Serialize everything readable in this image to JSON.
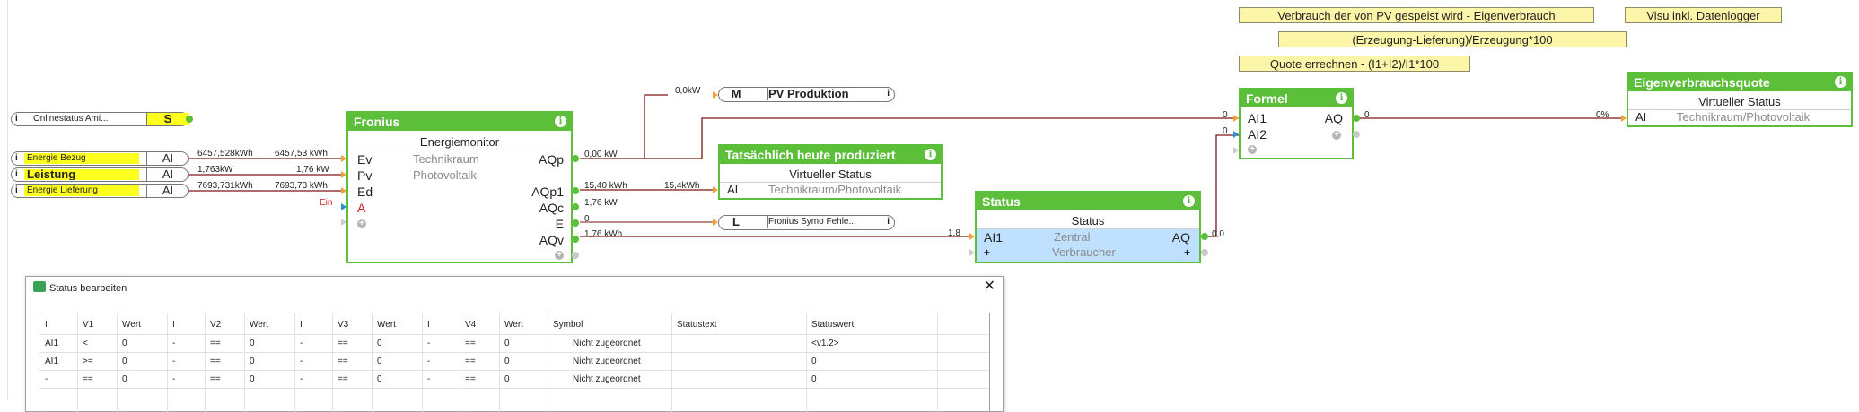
{
  "notes": {
    "eigenverbrauch": "Verbrauch der von PV gespeist wird - Eigenverbrauch",
    "visu": "Visu inkl. Datenlogger",
    "formula1": "(Erzeugung-Lieferung)/Erzeugung*100",
    "formula2": "Quote errechnen - (I1+I2)/I1*100"
  },
  "inputs": {
    "online": {
      "label": "Onlinestatus Ami...",
      "tag": "S"
    },
    "bezug": {
      "label": "Energie Bezug",
      "tag": "AI",
      "value": "6457,528kWh"
    },
    "leistung": {
      "label": "Leistung",
      "tag": "AI",
      "value": "1,763kW"
    },
    "lieferung": {
      "label": "Energie Lieferung",
      "tag": "AI",
      "value": "7693,731kWh"
    }
  },
  "fronius": {
    "title": "Fronius",
    "subtitle": "Energiemonitor",
    "room": "Technikraum",
    "category": "Photovoltaik",
    "inputs": [
      "Ev",
      "Pv",
      "Ed",
      "A"
    ],
    "outputs": [
      "AQp",
      "AQp1",
      "AQc",
      "E",
      "AQv"
    ],
    "in_values": [
      "6457,53 kWh",
      "1,76 kW",
      "7693,73 kWh"
    ],
    "ein": "Ein",
    "out_values": [
      "0,00 kW",
      "15,40 kWh",
      "1,76 kW",
      "0",
      "1,76 kWh"
    ]
  },
  "pv_produktion": {
    "tag": "M",
    "label": "PV Produktion",
    "value": "0,0kW"
  },
  "heute": {
    "title": "Tatsächlich heute produziert",
    "subtitle": "Virtueller Status",
    "input": "AI",
    "path": "Technikraum/Photovoltaik",
    "value": "15,4kWh"
  },
  "fehler": {
    "tag": "L",
    "label": "Fronius Symo Fehle..."
  },
  "status": {
    "title": "Status",
    "subtitle": "Status",
    "input": "AI1",
    "room": "Zentral",
    "output": "AQ",
    "category": "Verbraucher",
    "in_value": "1,8",
    "out_value": "0,0"
  },
  "formel": {
    "title": "Formel",
    "inputs": [
      "AI1",
      "AI2"
    ],
    "output": "AQ",
    "in_values": [
      "0",
      "0"
    ],
    "out_value": "0"
  },
  "eigenquote": {
    "title": "Eigenverbrauchsquote",
    "subtitle": "Virtueller Status",
    "input": "AI",
    "path": "Technikraum/Photovoltaik",
    "value": "0%"
  },
  "dialog": {
    "title": "Status bearbeiten",
    "headers": [
      "I",
      "V1",
      "Wert",
      "I",
      "V2",
      "Wert",
      "I",
      "V3",
      "Wert",
      "I",
      "V4",
      "Wert",
      "Symbol",
      "Statustext",
      "Statuswert"
    ],
    "rows": [
      [
        "AI1",
        "<",
        "0",
        "-",
        "==",
        "0",
        "-",
        "==",
        "0",
        "-",
        "==",
        "0",
        "Nicht zugeordnet",
        "",
        "<v1.2>"
      ],
      [
        "AI1",
        ">=",
        "0",
        "-",
        "==",
        "0",
        "-",
        "==",
        "0",
        "-",
        "==",
        "0",
        "Nicht zugeordnet",
        "",
        "0"
      ],
      [
        "-",
        "==",
        "0",
        "-",
        "==",
        "0",
        "-",
        "==",
        "0",
        "-",
        "==",
        "0",
        "Nicht zugeordnet",
        "",
        "0"
      ]
    ]
  }
}
